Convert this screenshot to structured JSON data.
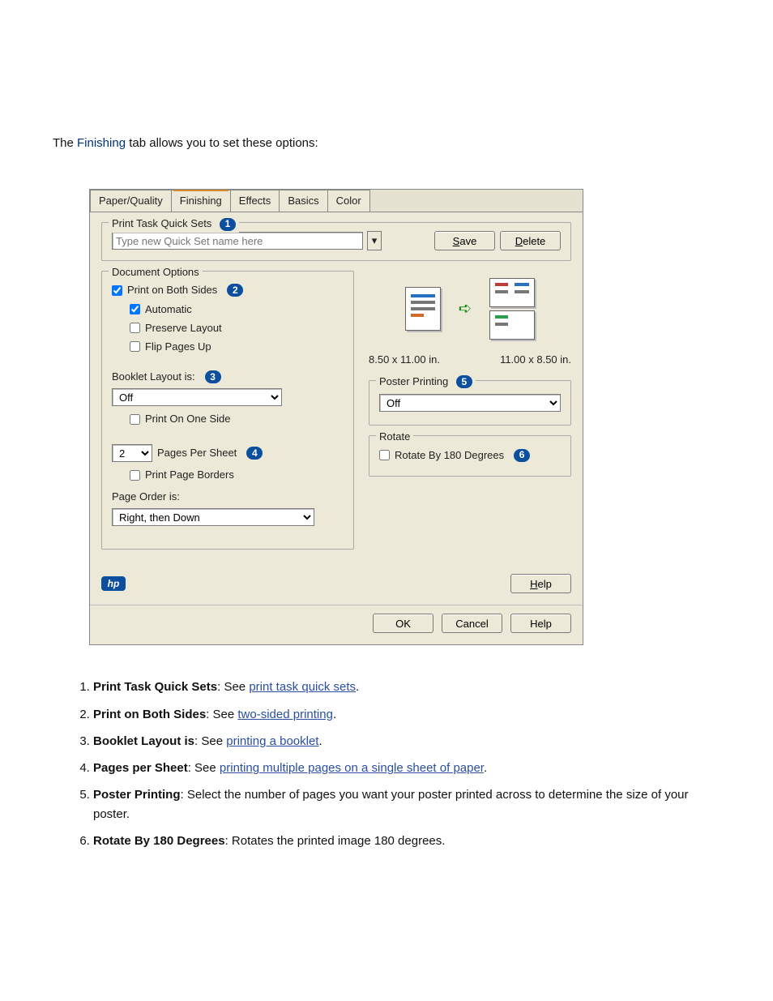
{
  "intro": {
    "prefix": "The ",
    "keyword": "Finishing",
    "suffix": " tab allows you to set these options:"
  },
  "dialog": {
    "tabs": [
      {
        "label": "Paper/Quality",
        "active": false
      },
      {
        "label": "Finishing",
        "active": true
      },
      {
        "label": "Effects",
        "active": false
      },
      {
        "label": "Basics",
        "active": false
      },
      {
        "label": "Color",
        "active": false
      }
    ],
    "quicksets": {
      "legend": "Print Task Quick Sets",
      "badge": "1",
      "placeholder": "Type new Quick Set name here",
      "save_label": "Save",
      "delete_label": "Delete"
    },
    "docopts": {
      "legend": "Document Options",
      "print_both_sides": {
        "label": "Print on Both Sides",
        "checked": true,
        "badge": "2"
      },
      "automatic": {
        "label": "Automatic",
        "checked": true
      },
      "preserve_layout": {
        "label": "Preserve Layout",
        "checked": false
      },
      "flip_pages_up": {
        "label": "Flip Pages Up",
        "checked": false
      },
      "booklet": {
        "label": "Booklet Layout is:",
        "badge": "3",
        "value": "Off"
      },
      "print_one_side": {
        "label": "Print On One Side",
        "checked": false
      },
      "pages_per_sheet": {
        "value": "2",
        "label": "Pages Per Sheet",
        "badge": "4"
      },
      "print_borders": {
        "label": "Print Page Borders",
        "checked": false
      },
      "page_order": {
        "label": "Page Order is:",
        "value": "Right, then Down"
      }
    },
    "preview": {
      "left_caption": "8.50 x 11.00 in.",
      "right_caption": "11.00 x 8.50 in."
    },
    "poster": {
      "legend": "Poster Printing",
      "badge": "5",
      "value": "Off"
    },
    "rotate": {
      "legend": "Rotate",
      "checkbox_label": "Rotate By 180 Degrees",
      "badge": "6",
      "checked": false
    },
    "help_link": "Help",
    "buttons": {
      "ok": "OK",
      "cancel": "Cancel",
      "help": "Help"
    }
  },
  "legend": {
    "items": [
      {
        "num": "1",
        "title": "Print Task Quick Sets",
        "sep": ": See ",
        "link": "print task quick sets",
        "tail": "."
      },
      {
        "num": "2",
        "title": "Print on Both Sides",
        "sep": ": See ",
        "link": "two-sided printing",
        "tail": "."
      },
      {
        "num": "3",
        "title": "Booklet Layout is",
        "sep": ": See ",
        "link": "printing a booklet",
        "tail": "."
      },
      {
        "num": "4",
        "title": "Pages per Sheet",
        "sep": ": See ",
        "link": "printing multiple pages on a single sheet of paper",
        "tail": "."
      },
      {
        "num": "5",
        "title": "Poster Printing",
        "sep": ": Select the number of pages you want your poster printed across to determine the size of your poster.",
        "link": "",
        "tail": ""
      },
      {
        "num": "6",
        "title": "Rotate By 180 Degrees",
        "sep": ": Rotates the printed image 180 degrees.",
        "link": "",
        "tail": ""
      }
    ]
  }
}
